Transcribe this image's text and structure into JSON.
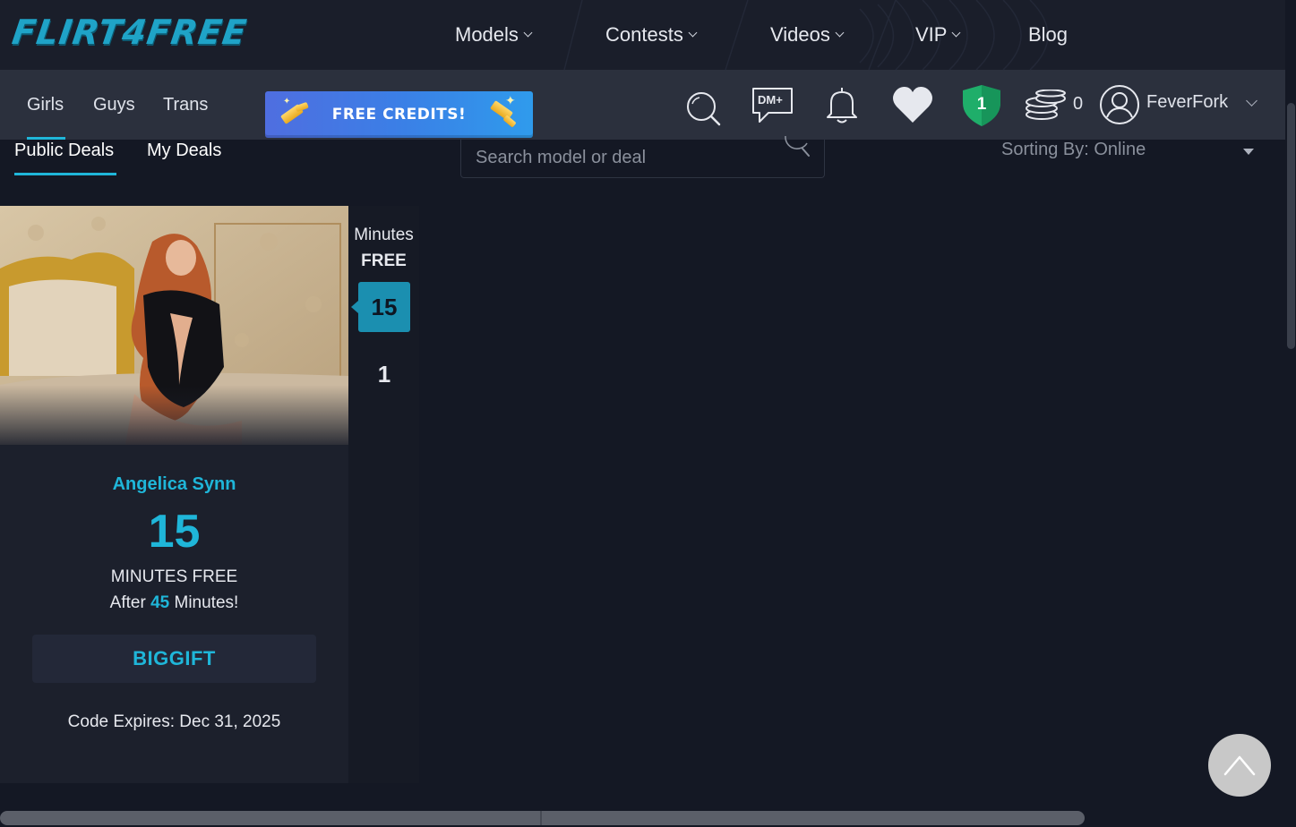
{
  "brand": {
    "logo_text": "FLIRT4FREE",
    "accent": "#1fb6d9"
  },
  "main_nav": [
    {
      "label": "Models",
      "has_dropdown": true
    },
    {
      "label": "Contests",
      "has_dropdown": true
    },
    {
      "label": "Videos",
      "has_dropdown": true
    },
    {
      "label": "VIP",
      "has_dropdown": true
    },
    {
      "label": "Blog",
      "has_dropdown": false
    }
  ],
  "categories": [
    {
      "label": "Girls",
      "active": true
    },
    {
      "label": "Guys",
      "active": false
    },
    {
      "label": "Trans",
      "active": false
    }
  ],
  "promo": {
    "label": "FREE CREDITS!"
  },
  "header_icons": {
    "search": "search-icon",
    "dm": "DM+",
    "notifications": "bell-icon",
    "favorites": "heart-icon",
    "rank_badge": "1",
    "coins": "0"
  },
  "user": {
    "name": "FeverFork"
  },
  "deals_tabs": [
    {
      "label": "Public Deals",
      "active": true
    },
    {
      "label": "My Deals",
      "active": false
    }
  ],
  "search": {
    "placeholder": "Search model or deal",
    "value": ""
  },
  "sorting": {
    "label": "Sorting By: Online"
  },
  "deal": {
    "model_name": "Angelica Synn",
    "minutes": "15",
    "minutes_free_label": "MINUTES FREE",
    "after_prefix": "After",
    "after_minutes": "45",
    "after_suffix": "Minutes!",
    "code": "BIGGIFT",
    "expires": "Code Expires: Dec 31, 2025"
  },
  "minutes_column": {
    "title": "Minutes",
    "subtitle": "FREE",
    "options": [
      "15",
      "1"
    ],
    "selected": "15"
  }
}
